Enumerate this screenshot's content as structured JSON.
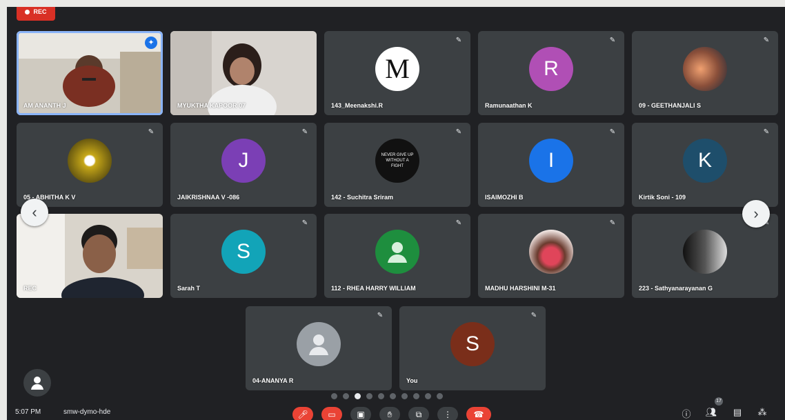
{
  "recording": {
    "label": "REC"
  },
  "participants": [
    {
      "name": "AM ANANTH J",
      "type": "video",
      "active": true
    },
    {
      "name": "MYUKTHA KAPOOR 07",
      "type": "video"
    },
    {
      "name": "143_Meenakshi.R",
      "type": "avatar",
      "avatar_text": "M",
      "avatar_color": "#ffffff",
      "avatar_fg": "#111111"
    },
    {
      "name": "Ramunaathan K",
      "type": "avatar",
      "avatar_text": "R",
      "avatar_color": "#b04fb5"
    },
    {
      "name": "09 - GEETHANJALI S",
      "type": "avatar-photo",
      "avatar_color": "#d7c6b8"
    },
    {
      "name": "05 - ABHITHA K V",
      "type": "avatar-photo",
      "avatar_color": "#a58a1e"
    },
    {
      "name": "JAIKRISHNAA V -086",
      "type": "avatar",
      "avatar_text": "J",
      "avatar_color": "#7b3fb5"
    },
    {
      "name": "142 - Suchitra Sriram",
      "type": "avatar-photo",
      "avatar_color": "#111111",
      "avatar_text": "NEVER GIVE UP WITHOUT A FIGHT"
    },
    {
      "name": "ISAIMOZHI B",
      "type": "avatar",
      "avatar_text": "I",
      "avatar_color": "#1a73e8"
    },
    {
      "name": "Kirtik Soni - 109",
      "type": "avatar",
      "avatar_text": "K",
      "avatar_color": "#1e4e6b"
    },
    {
      "name": "REC",
      "type": "video"
    },
    {
      "name": "Sarah T",
      "type": "avatar",
      "avatar_text": "S",
      "avatar_color": "#12a4b8"
    },
    {
      "name": "112 - RHEA HARRY WILLIAM",
      "type": "avatar-generic",
      "avatar_color": "#1e8e3e"
    },
    {
      "name": "MADHU HARSHINI M-31",
      "type": "avatar-photo",
      "avatar_color": "#e8d3d0"
    },
    {
      "name": "223 - Sathyanarayanan G",
      "type": "avatar-photo",
      "avatar_color": "#2a2a2a"
    },
    {
      "name": "04-ANANYA R",
      "type": "avatar-generic",
      "avatar_color": "#9aa0a6"
    },
    {
      "name": "You",
      "type": "avatar",
      "avatar_text": "S",
      "avatar_color": "#7a2e1a"
    }
  ],
  "pagination": {
    "total": 10,
    "current": 3
  },
  "bottom_bar": {
    "time": "5:07 PM",
    "meeting_code": "smw-dymo-hde",
    "participant_count": "17"
  },
  "icons": {
    "mic_off": "mic-off-icon",
    "cam_off": "camera-off-icon",
    "captions": "captions-icon",
    "raise_hand": "raise-hand-icon",
    "present": "present-icon",
    "more": "more-icon",
    "end_call": "end-call-icon",
    "info": "info-icon",
    "people": "people-icon",
    "chat": "chat-icon",
    "activities": "activities-icon"
  }
}
